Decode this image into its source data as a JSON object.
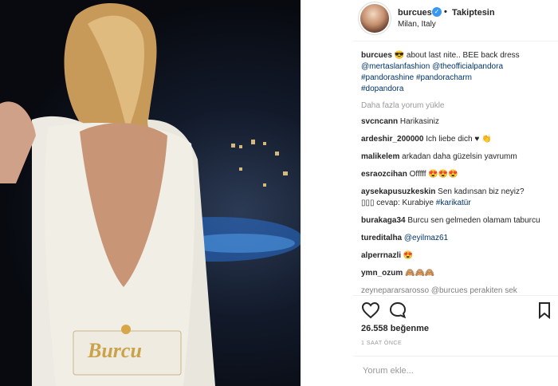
{
  "post": {
    "username": "burcues",
    "follow_label": "Takiptesin",
    "separator": "•",
    "location": "Milan, Italy",
    "photo_lettering": "Burcu"
  },
  "caption": {
    "user": "burcues",
    "text": "about last nite.. BEE back dress",
    "tags": [
      "@mertaslanfashion",
      "@theofficialpandora",
      "#pandorashine",
      "#pandoracharm",
      "#dopandora"
    ]
  },
  "load_more_label": "Daha fazla yorum yükle",
  "comments": [
    {
      "user": "svcncann",
      "text": "Harikasiniz"
    },
    {
      "user": "ardeshir_200000",
      "text": "Ich liebe dich ♥",
      "emoji": [
        "clap-emoji"
      ]
    },
    {
      "user": "malikelem",
      "text": "arkadan daha güzelsin yavrumm"
    },
    {
      "user": "esraozcihan",
      "text": "Offfff",
      "emoji": [
        "heart-eyes-emoji",
        "heart-eyes-emoji",
        "heart-eyes-emoji"
      ]
    },
    {
      "user": "aysekapusuzkeskin",
      "text": "Sen kadınsan biz neyiz?",
      "line2": "cevap: Kurabiye",
      "tag": "#karikatür"
    },
    {
      "user": "burakaga34",
      "text": "Burcu sen gelmeden olamam taburcu"
    },
    {
      "user": "tureditalha",
      "tag": "@eyilmaz61"
    },
    {
      "user": "alperrnazli",
      "emoji": [
        "heart-eyes-emoji"
      ]
    },
    {
      "user": "ymn_ozum",
      "emoji": [
        "see-no-evil-emoji",
        "see-no-evil-emoji",
        "see-no-evil-emoji"
      ]
    }
  ],
  "partial_comment": "zeynepararsarosso @burcues perakiten sek",
  "likes_label": "26.558 beğenme",
  "time_label": "1 SAAT ÖNCE",
  "comment_placeholder": "Yorum ekle...",
  "colors": {
    "link": "#003569",
    "verified": "#3897f0",
    "muted": "#999999"
  }
}
